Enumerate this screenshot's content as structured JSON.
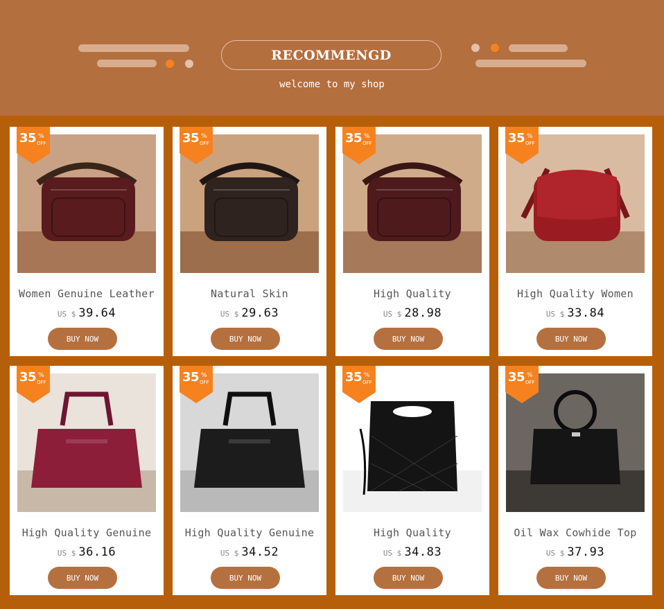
{
  "header": {
    "title": "RECOMMENGD",
    "subtitle": "welcome to my shop"
  },
  "colors": {
    "header_bg": "#b46f3f",
    "page_bg": "#b65f0a",
    "badge": "#f5821f",
    "button": "#b5703f"
  },
  "products": [
    {
      "discount": "35",
      "percent_sign": "%",
      "off_label": "OFF",
      "name": "Women Genuine Leather",
      "currency": "US $",
      "price": "39.64",
      "button": "BUY NOW",
      "image": "burgundy-leather-shoulder-bag"
    },
    {
      "discount": "35",
      "percent_sign": "%",
      "off_label": "OFF",
      "name": "Natural Skin",
      "currency": "US $",
      "price": "29.63",
      "button": "BUY NOW",
      "image": "dark-brown-leather-shoulder-bag"
    },
    {
      "discount": "35",
      "percent_sign": "%",
      "off_label": "OFF",
      "name": "High Quality",
      "currency": "US $",
      "price": "28.98",
      "button": "BUY NOW",
      "image": "maroon-leather-shoulder-bag"
    },
    {
      "discount": "35",
      "percent_sign": "%",
      "off_label": "OFF",
      "name": "High Quality Women",
      "currency": "US $",
      "price": "33.84",
      "button": "BUY NOW",
      "image": "red-leather-shoulder-bag"
    },
    {
      "discount": "35",
      "percent_sign": "%",
      "off_label": "OFF",
      "name": "High Quality Genuine",
      "currency": "US $",
      "price": "36.16",
      "button": "BUY NOW",
      "image": "wine-red-tote-bag"
    },
    {
      "discount": "35",
      "percent_sign": "%",
      "off_label": "OFF",
      "name": "High Quality Genuine",
      "currency": "US $",
      "price": "34.52",
      "button": "BUY NOW",
      "image": "black-top-handle-bag"
    },
    {
      "discount": "35",
      "percent_sign": "%",
      "off_label": "OFF",
      "name": "High Quality",
      "currency": "US $",
      "price": "34.83",
      "button": "BUY NOW",
      "image": "black-quilted-cutout-handle-bag"
    },
    {
      "discount": "35",
      "percent_sign": "%",
      "off_label": "OFF",
      "name": "Oil Wax Cowhide Top",
      "currency": "US $",
      "price": "37.93",
      "button": "BUY NOW",
      "image": "black-ring-handle-bag"
    }
  ]
}
